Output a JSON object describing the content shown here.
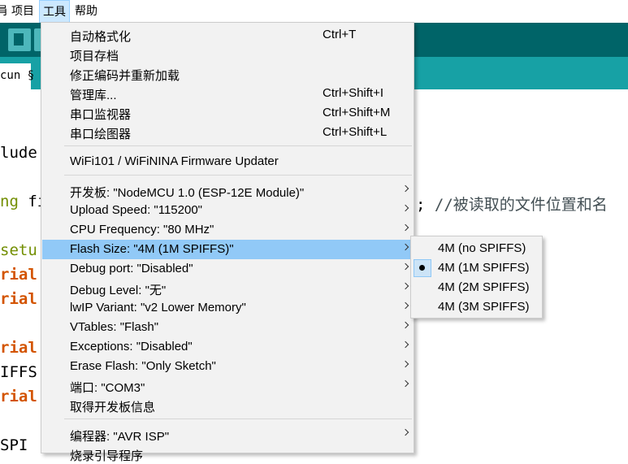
{
  "menubar": {
    "items": [
      {
        "label": "肙"
      },
      {
        "label": "项目"
      },
      {
        "label": "工具"
      },
      {
        "label": "帮助"
      }
    ]
  },
  "tab": {
    "label": "cun §"
  },
  "code_lines": [
    {
      "text": "lude"
    },
    {
      "kw": "ng",
      "rest": " fi",
      "tail": "; ",
      "comment": "//被读取的文件位置和名"
    },
    {
      "text": "setu"
    },
    {
      "fn": "rial"
    },
    {
      "fn": "rial"
    },
    {
      "fn": "rial"
    },
    {
      "text": "IFFS"
    },
    {
      "fn": "rial"
    },
    {
      "text": "SPI"
    }
  ],
  "tools_menu": {
    "items": [
      {
        "label": "自动格式化",
        "shortcut": "Ctrl+T"
      },
      {
        "label": "项目存档",
        "shortcut": ""
      },
      {
        "label": "修正编码并重新加载",
        "shortcut": ""
      },
      {
        "label": "管理库...",
        "shortcut": "Ctrl+Shift+I"
      },
      {
        "label": "串口监视器",
        "shortcut": "Ctrl+Shift+M"
      },
      {
        "label": "串口绘图器",
        "shortcut": "Ctrl+Shift+L"
      },
      {
        "label": "WiFi101 / WiFiNINA Firmware Updater",
        "shortcut": ""
      },
      {
        "label": "开发板: \"NodeMCU 1.0 (ESP-12E Module)\"",
        "shortcut": ""
      },
      {
        "label": "Upload Speed: \"115200\"",
        "shortcut": ""
      },
      {
        "label": "CPU Frequency: \"80 MHz\"",
        "shortcut": ""
      },
      {
        "label": "Flash Size: \"4M (1M SPIFFS)\"",
        "shortcut": ""
      },
      {
        "label": "Debug port: \"Disabled\"",
        "shortcut": ""
      },
      {
        "label": "Debug Level: \"无\"",
        "shortcut": ""
      },
      {
        "label": "lwIP Variant: \"v2 Lower Memory\"",
        "shortcut": ""
      },
      {
        "label": "VTables: \"Flash\"",
        "shortcut": ""
      },
      {
        "label": "Exceptions: \"Disabled\"",
        "shortcut": ""
      },
      {
        "label": "Erase Flash: \"Only Sketch\"",
        "shortcut": ""
      },
      {
        "label": "端口: \"COM3\"",
        "shortcut": ""
      },
      {
        "label": "取得开发板信息",
        "shortcut": ""
      },
      {
        "label": "编程器: \"AVR ISP\"",
        "shortcut": ""
      },
      {
        "label": "烧录引导程序",
        "shortcut": ""
      }
    ]
  },
  "flash_submenu": {
    "items": [
      {
        "label": "4M (no SPIFFS)"
      },
      {
        "label": "4M (1M SPIFFS)",
        "selected": true
      },
      {
        "label": "4M (2M SPIFFS)"
      },
      {
        "label": "4M (3M SPIFFS)"
      }
    ]
  },
  "colors": {
    "toolbar": "#006468",
    "tabbar": "#17a1a5",
    "highlight": "#91c9f7",
    "keyword": "#728e00",
    "function": "#d35400"
  }
}
